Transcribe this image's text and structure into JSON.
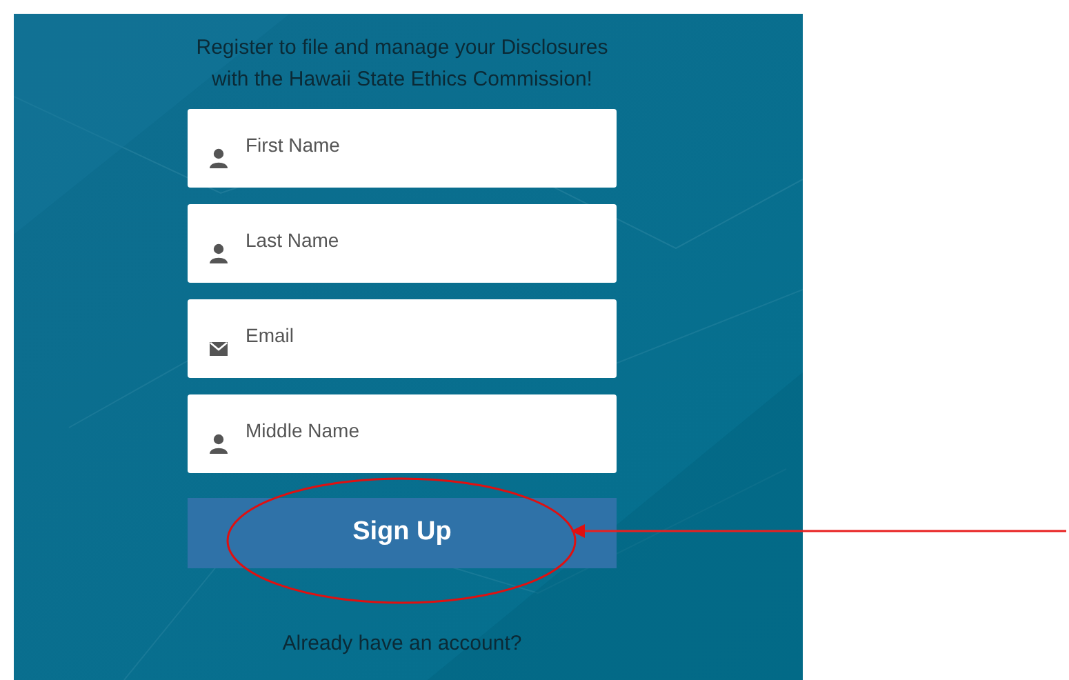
{
  "intro": "Register to file and manage your Disclosures with the Hawaii State Ethics Commission!",
  "fields": [
    {
      "placeholder": "First Name",
      "kind": "person"
    },
    {
      "placeholder": "Last Name",
      "kind": "person"
    },
    {
      "placeholder": "Email",
      "kind": "mail"
    },
    {
      "placeholder": "Middle Name",
      "kind": "person"
    }
  ],
  "submit": "Sign Up",
  "login_link": "Already have an account?"
}
